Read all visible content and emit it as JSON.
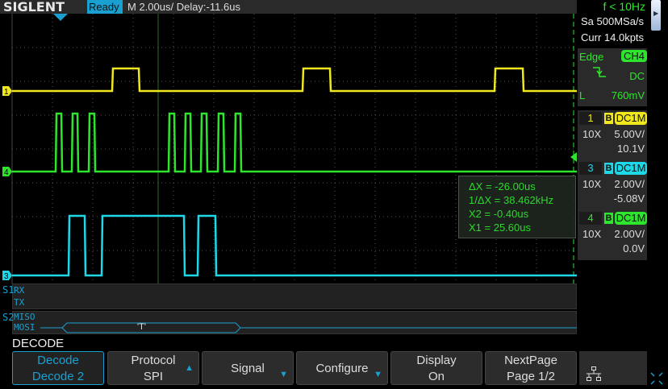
{
  "header": {
    "logo": "SIGLENT",
    "status": "Ready",
    "timebase": "M 2.00us/  Delay:-11.6us",
    "frequency": "f < 10Hz"
  },
  "acquisition": {
    "sample_rate": "Sa 500MSa/s",
    "memory": "Curr 14.0kpts"
  },
  "trigger": {
    "type": "Edge",
    "source": "CH4",
    "slope_icon": "falling-edge-icon",
    "coupling": "DC",
    "level_label": "L",
    "level": "760mV"
  },
  "channels": [
    {
      "num": "1",
      "bw": "B",
      "coupling": "DC1M",
      "probe": "10X",
      "scale": "5.00V/",
      "offset": "10.1V",
      "color": "#f0e81c"
    },
    {
      "num": "3",
      "bw": "B",
      "coupling": "DC1M",
      "probe": "10X",
      "scale": "2.00V/",
      "offset": "-5.08V",
      "color": "#1ed8e8"
    },
    {
      "num": "4",
      "bw": "B",
      "coupling": "DC1M",
      "probe": "10X",
      "scale": "2.00V/",
      "offset": "0.0V",
      "color": "#2ee52e"
    }
  ],
  "trace_markers": {
    "ch1": "1",
    "ch4": "4",
    "ch3": "3"
  },
  "cursors": {
    "dx": "ΔX = -26.00us",
    "inv_dx": "1/ΔX = 38.462kHz",
    "x2": "X2 = -0.40us",
    "x1": "X1 = 25.60us"
  },
  "decode": {
    "s1": {
      "label": "S1",
      "lines": [
        "RX",
        "TX"
      ]
    },
    "s2": {
      "label": "S2",
      "lines": [
        "MISO",
        "MOSI"
      ],
      "mosi_value": "'T'"
    }
  },
  "menu": {
    "title": "DECODE",
    "buttons": [
      {
        "top": "Decode",
        "bottom": "Decode 2"
      },
      {
        "top": "Protocol",
        "bottom": "SPI"
      },
      {
        "top": "Signal",
        "bottom": ""
      },
      {
        "top": "Configure",
        "bottom": ""
      },
      {
        "top": "Display",
        "bottom": "On"
      },
      {
        "top": "NextPage",
        "bottom": "Page 1/2"
      }
    ]
  }
}
